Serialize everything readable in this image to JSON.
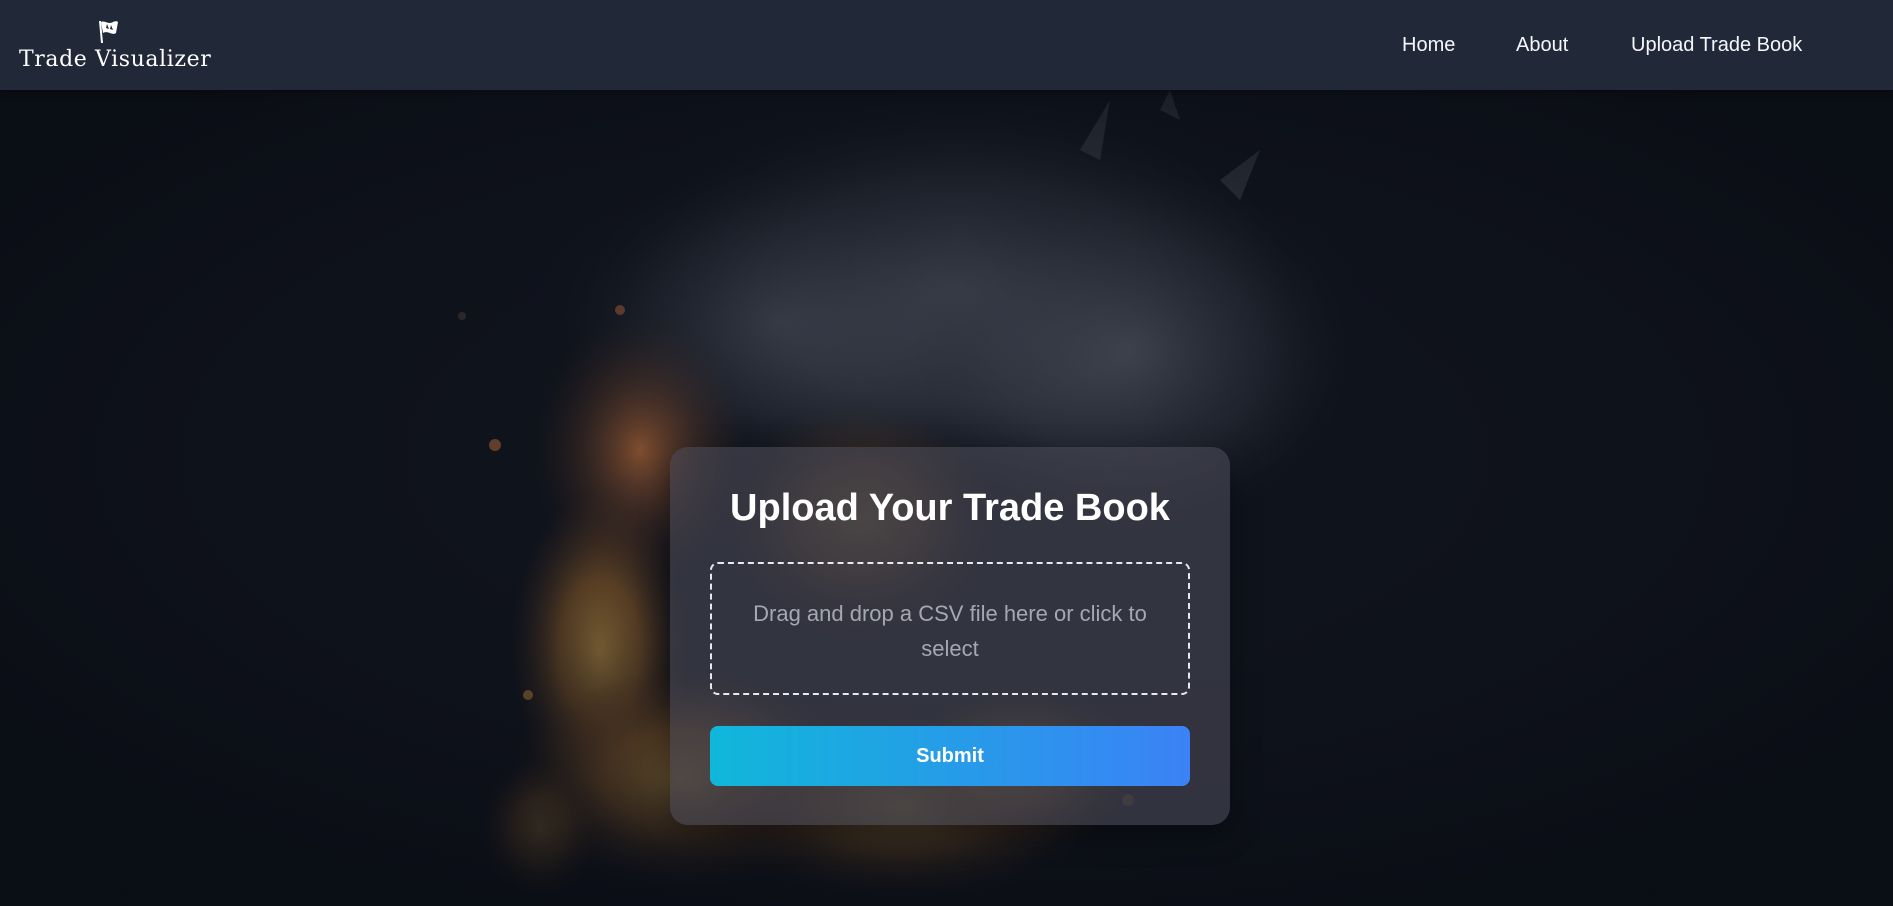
{
  "navbar": {
    "brand_name": "Trade Visualizer",
    "logo_icon": "flag-logo-icon",
    "links": [
      {
        "label": "Home"
      },
      {
        "label": "About"
      },
      {
        "label": "Upload Trade Book"
      }
    ]
  },
  "upload_card": {
    "title": "Upload Your Trade Book",
    "dropzone_text": "Drag and drop a CSV file here or click to select",
    "submit_label": "Submit"
  },
  "colors": {
    "navbar_bg": "#212938",
    "page_bg": "#0f131c",
    "button_gradient_start": "#10b7da",
    "button_gradient_end": "#3b82f6",
    "card_bg": "rgba(72,72,86,0.62)"
  }
}
